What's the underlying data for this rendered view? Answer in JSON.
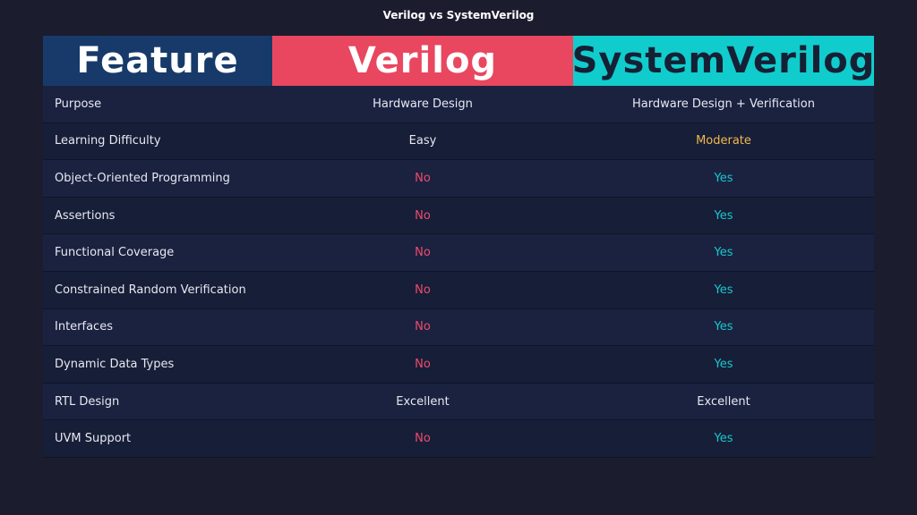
{
  "title": "Verilog vs SystemVerilog",
  "colors": {
    "feature_header": "#173a6a",
    "verilog_header": "#e8475f",
    "systemverilog_header": "#11cccc",
    "no": "#ef4b6a",
    "yes": "#19c8cc",
    "moderate": "#f2b84b"
  },
  "table": {
    "headers": [
      "Feature",
      "Verilog",
      "SystemVerilog"
    ],
    "rows": [
      {
        "feature": "Purpose",
        "verilog": "Hardware Design",
        "systemverilog": "Hardware Design + Verification"
      },
      {
        "feature": "Learning Difficulty",
        "verilog": "Easy",
        "systemverilog": "Moderate"
      },
      {
        "feature": "Object-Oriented Programming",
        "verilog": "No",
        "systemverilog": "Yes"
      },
      {
        "feature": "Assertions",
        "verilog": "No",
        "systemverilog": "Yes"
      },
      {
        "feature": "Functional Coverage",
        "verilog": "No",
        "systemverilog": "Yes"
      },
      {
        "feature": "Constrained Random Verification",
        "verilog": "No",
        "systemverilog": "Yes"
      },
      {
        "feature": "Interfaces",
        "verilog": "No",
        "systemverilog": "Yes"
      },
      {
        "feature": "Dynamic Data Types",
        "verilog": "No",
        "systemverilog": "Yes"
      },
      {
        "feature": "RTL Design",
        "verilog": "Excellent",
        "systemverilog": "Excellent"
      },
      {
        "feature": "UVM Support",
        "verilog": "No",
        "systemverilog": "Yes"
      }
    ]
  }
}
